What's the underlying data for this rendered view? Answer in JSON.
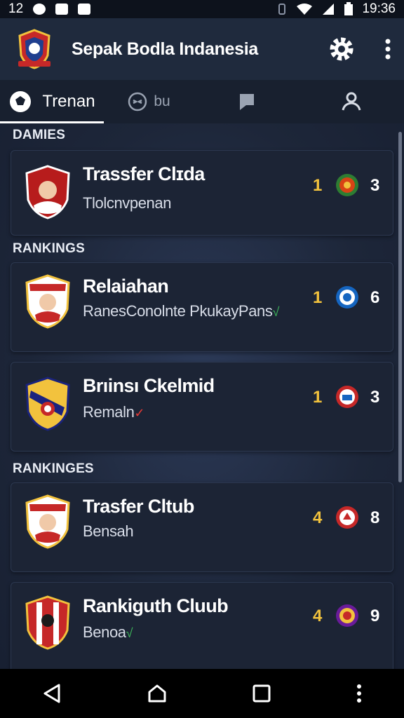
{
  "status": {
    "left_time": "12",
    "right_time": "19:36"
  },
  "header": {
    "title": "Sepak Bodlа Indanesia"
  },
  "tabs": [
    {
      "label": "Trenan",
      "icon": "ball-icon"
    },
    {
      "label": "bu",
      "icon": "scoreboard-icon"
    },
    {
      "label": "",
      "icon": "flag-icon"
    },
    {
      "label": "",
      "icon": "profile-icon"
    }
  ],
  "sections": [
    {
      "title": "DAMIES"
    },
    {
      "title": "RANKINGS"
    },
    {
      "title": "RANKINGES"
    }
  ],
  "cards": [
    {
      "title": "Trassfer Clɪda",
      "subtitle": "Tlolcnvpenan",
      "mark": "",
      "rank": "1",
      "score": "3"
    },
    {
      "title": "Relаiahan",
      "subtitle": "RanesConolnte   PkukayPans",
      "mark": "√",
      "rank": "1",
      "score": "6"
    },
    {
      "title": "Brıinsı Ckelmid",
      "subtitle": "Remaln",
      "mark": "✓",
      "rank": "1",
      "score": "3"
    },
    {
      "title": "Trasfer Cltub",
      "subtitle": "Bensah",
      "mark": "",
      "rank": "4",
      "score": "8"
    },
    {
      "title": "Rankiguth Cluub",
      "subtitle": "Benoa",
      "mark": "√",
      "rank": "4",
      "score": "9"
    }
  ],
  "colors": {
    "accent": "#f2c23d",
    "card": "#1c2435",
    "background": "#1b2436"
  }
}
